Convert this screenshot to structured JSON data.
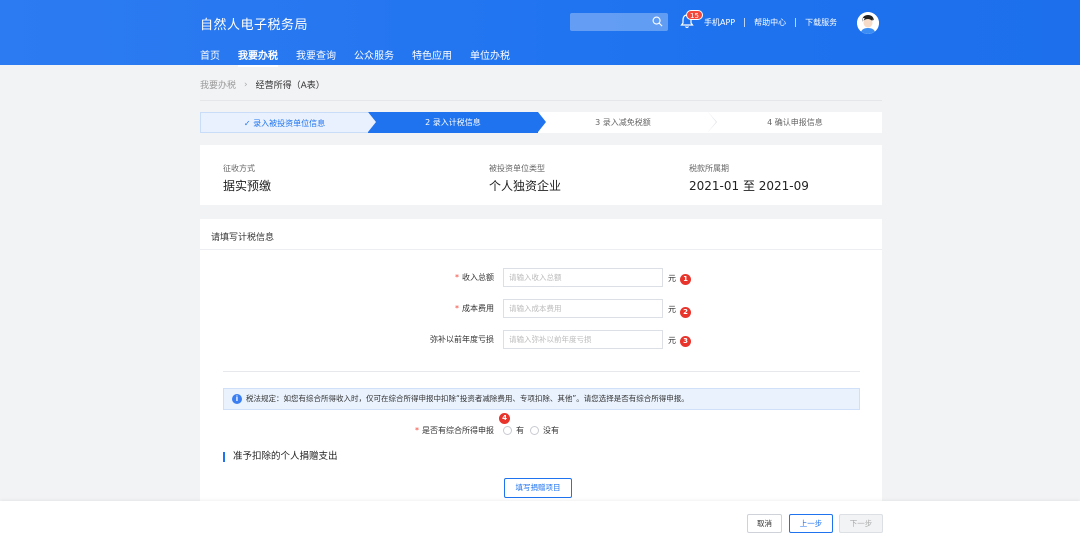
{
  "header": {
    "brand": "自然人电子税务局",
    "nav": [
      "首页",
      "我要办税",
      "我要查询",
      "公众服务",
      "特色应用",
      "单位办税"
    ],
    "active_nav": "我要办税",
    "notification_count": "15",
    "links": [
      "手机APP",
      "帮助中心",
      "下载服务"
    ],
    "accent": "#1f73ef"
  },
  "breadcrumb": {
    "parent": "我要办税",
    "current": "经营所得（A表）"
  },
  "steps": [
    {
      "label": "✓ 录入被投资单位信息",
      "state": "done"
    },
    {
      "label": "2 录入计税信息",
      "state": "active"
    },
    {
      "label": "3 录入减免税额",
      "state": "todo"
    },
    {
      "label": "4 确认申报信息",
      "state": "todo"
    }
  ],
  "info": {
    "collection_label": "征收方式",
    "collection_value": "据实预缴",
    "unit_type_label": "被投资单位类型",
    "unit_type_value": "个人独资企业",
    "period_label": "税款所属期",
    "period_value": "2021-01 至 2021-09"
  },
  "form": {
    "title": "请填写计税信息",
    "fields": [
      {
        "label": "收入总额",
        "required": true,
        "placeholder": "请输入收入总额",
        "unit": "元",
        "badge": "1"
      },
      {
        "label": "成本费用",
        "required": true,
        "placeholder": "请输入成本费用",
        "unit": "元",
        "badge": "2"
      },
      {
        "label": "弥补以前年度亏损",
        "required": false,
        "placeholder": "请输入弥补以前年度亏损",
        "unit": "元",
        "badge": "3"
      }
    ],
    "notice": "税法规定：如您有综合所得收入时，仅可在综合所得申报中扣除“投资者减除费用、专项扣除、其他”。请您选择是否有综合所得申报。",
    "radio_label": "是否有综合所得申报",
    "radio_badge": "4",
    "radio_options": [
      "有",
      "没有"
    ],
    "section_title": "准予扣除的个人捐赠支出",
    "donate_button": "填写捐赠项目"
  },
  "footer": {
    "cancel": "取消",
    "prev": "上一步",
    "next": "下一步"
  }
}
